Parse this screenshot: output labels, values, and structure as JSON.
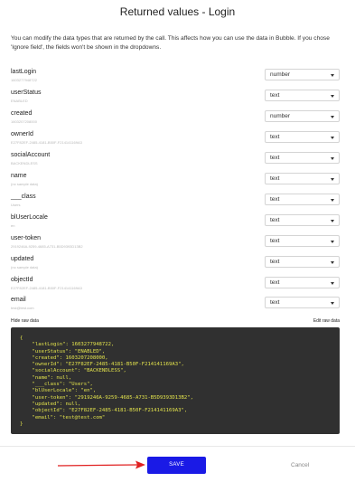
{
  "modal": {
    "title": "Returned values - Login",
    "intro": "You can modify the data types that are returned by the call. This affects how you can use the data in Bubble. If you chose 'Ignore field', the fields won't be shown in the dropdowns."
  },
  "fields": [
    {
      "name": "lastLogin",
      "sample": "1603277948722",
      "type": "number"
    },
    {
      "name": "userStatus",
      "sample": "ENABLED",
      "type": "text"
    },
    {
      "name": "created",
      "sample": "1603207208000",
      "type": "number"
    },
    {
      "name": "ownerId",
      "sample": "E27F82EF-2485-4181-B50F-F214141169A3",
      "type": "text"
    },
    {
      "name": "socialAccount",
      "sample": "BACKENDLESS",
      "type": "text"
    },
    {
      "name": "name",
      "sample": "(no sample data)",
      "type": "text"
    },
    {
      "name": "___class",
      "sample": "Users",
      "type": "text"
    },
    {
      "name": "blUserLocale",
      "sample": "en",
      "type": "text"
    },
    {
      "name": "user-token",
      "sample": "2919246A-9259-4685-A731-B5D9393D13B2",
      "type": "text"
    },
    {
      "name": "updated",
      "sample": "(no sample data)",
      "type": "text"
    },
    {
      "name": "objectId",
      "sample": "E27F82EF-2485-4181-B50F-F214141169A3",
      "type": "text"
    },
    {
      "name": "email",
      "sample": "test@test.com",
      "type": "text"
    }
  ],
  "raw": {
    "hide_label": "Hide raw data",
    "edit_label": "Edit raw data",
    "content": "{\n    \"lastLogin\": 1603277948722,\n    \"userStatus\": \"ENABLED\",\n    \"created\": 1603207208000,\n    \"ownerId\": \"E27F82EF-2485-4181-B50F-F214141169A3\",\n    \"socialAccount\": \"BACKENDLESS\",\n    \"name\": null,\n    \"___class\": \"Users\",\n    \"blUserLocale\": \"en\",\n    \"user-token\": \"2919246A-9259-4685-A731-B5D9393D13B2\",\n    \"updated\": null,\n    \"objectId\": \"E27F82EF-2485-4181-B50F-F214141169A3\",\n    \"email\": \"test@test.com\"\n}"
  },
  "footer": {
    "save_label": "SAVE",
    "cancel_label": "Cancel"
  },
  "colors": {
    "save_button": "#1a1ae6",
    "arrow": "#e02020",
    "raw_background": "#303030",
    "raw_text": "#e2e24c"
  }
}
